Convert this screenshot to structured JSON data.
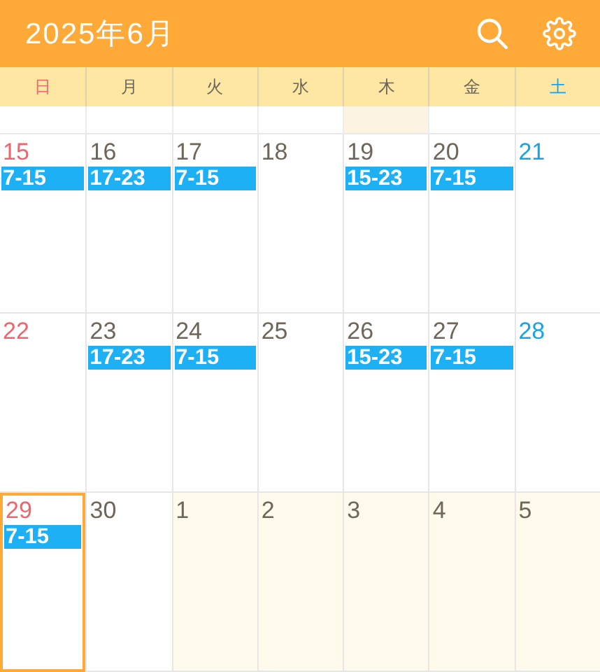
{
  "header": {
    "title": "2025年6月"
  },
  "weekdays": [
    {
      "label": "日",
      "kind": "sunday"
    },
    {
      "label": "月",
      "kind": "weekday"
    },
    {
      "label": "火",
      "kind": "weekday"
    },
    {
      "label": "水",
      "kind": "weekday"
    },
    {
      "label": "木",
      "kind": "weekday"
    },
    {
      "label": "金",
      "kind": "weekday"
    },
    {
      "label": "土",
      "kind": "saturday"
    }
  ],
  "partial_week": [
    {
      "highlighted": false
    },
    {
      "highlighted": false
    },
    {
      "highlighted": false
    },
    {
      "highlighted": false
    },
    {
      "highlighted": true
    },
    {
      "highlighted": false
    },
    {
      "highlighted": false
    }
  ],
  "weeks": [
    {
      "days": [
        {
          "day": "15",
          "kind": "sunday",
          "other_month": false,
          "selected": false,
          "shifts": [
            "7-15"
          ]
        },
        {
          "day": "16",
          "kind": "weekday",
          "other_month": false,
          "selected": false,
          "shifts": [
            "17-23"
          ]
        },
        {
          "day": "17",
          "kind": "weekday",
          "other_month": false,
          "selected": false,
          "shifts": [
            "7-15"
          ]
        },
        {
          "day": "18",
          "kind": "weekday",
          "other_month": false,
          "selected": false
        },
        {
          "day": "19",
          "kind": "weekday",
          "other_month": false,
          "selected": false,
          "shifts": [
            "15-23"
          ]
        },
        {
          "day": "20",
          "kind": "weekday",
          "other_month": false,
          "selected": false,
          "shifts": [
            "7-15"
          ]
        },
        {
          "day": "21",
          "kind": "saturday",
          "other_month": false,
          "selected": false
        }
      ]
    },
    {
      "days": [
        {
          "day": "22",
          "kind": "sunday",
          "other_month": false,
          "selected": false
        },
        {
          "day": "23",
          "kind": "weekday",
          "other_month": false,
          "selected": false,
          "shifts": [
            "17-23"
          ]
        },
        {
          "day": "24",
          "kind": "weekday",
          "other_month": false,
          "selected": false,
          "shifts": [
            "7-15"
          ]
        },
        {
          "day": "25",
          "kind": "weekday",
          "other_month": false,
          "selected": false
        },
        {
          "day": "26",
          "kind": "weekday",
          "other_month": false,
          "selected": false,
          "shifts": [
            "15-23"
          ]
        },
        {
          "day": "27",
          "kind": "weekday",
          "other_month": false,
          "selected": false,
          "shifts": [
            "7-15"
          ]
        },
        {
          "day": "28",
          "kind": "saturday",
          "other_month": false,
          "selected": false
        }
      ]
    },
    {
      "days": [
        {
          "day": "29",
          "kind": "sunday",
          "other_month": false,
          "selected": true,
          "shifts": [
            "7-15"
          ]
        },
        {
          "day": "30",
          "kind": "weekday",
          "other_month": false,
          "selected": false
        },
        {
          "day": "1",
          "kind": "weekday",
          "other_month": true,
          "selected": false
        },
        {
          "day": "2",
          "kind": "weekday",
          "other_month": true,
          "selected": false
        },
        {
          "day": "3",
          "kind": "weekday",
          "other_month": true,
          "selected": false
        },
        {
          "day": "4",
          "kind": "weekday",
          "other_month": true,
          "selected": false
        },
        {
          "day": "5",
          "kind": "weekday",
          "other_month": true,
          "selected": false
        }
      ]
    }
  ]
}
